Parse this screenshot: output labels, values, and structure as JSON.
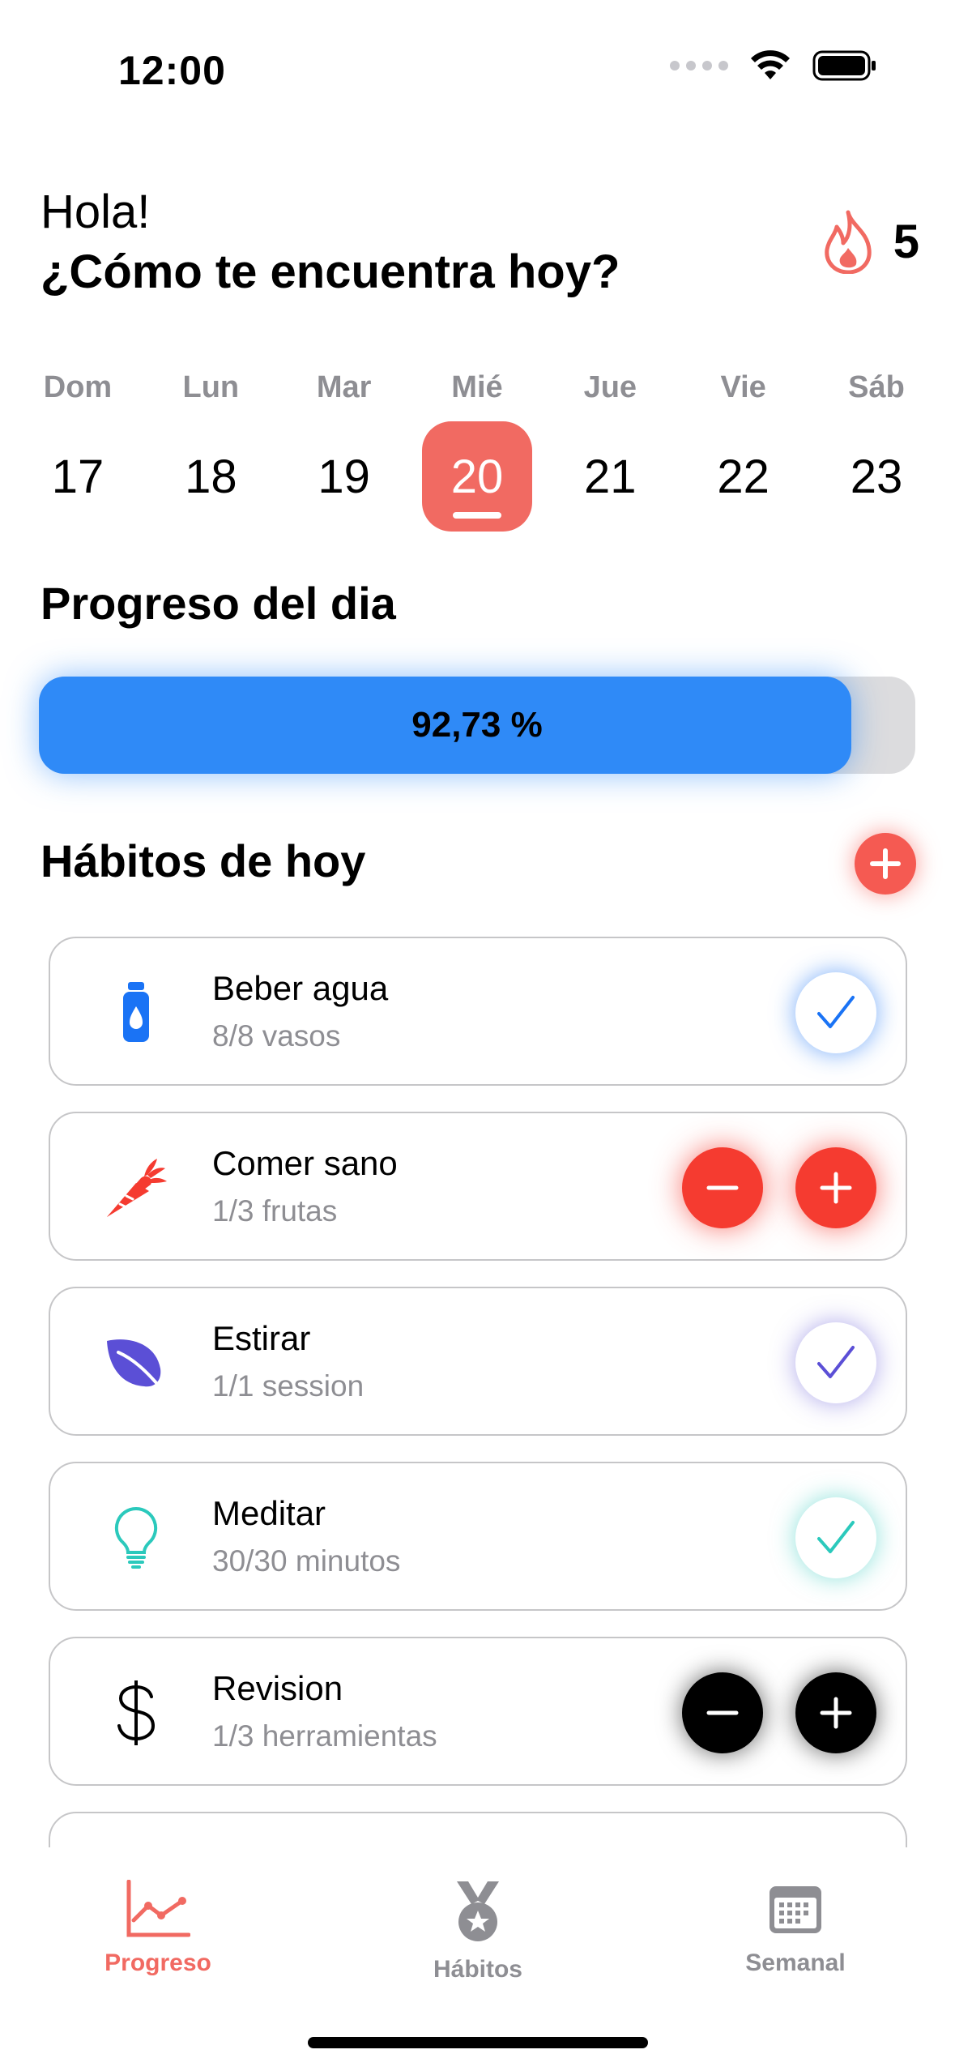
{
  "status_bar": {
    "time": "12:00",
    "icons": [
      "cellular-dots-icon",
      "wifi-icon",
      "battery-icon"
    ]
  },
  "header": {
    "greeting": "Hola!",
    "question": "¿Cómo te encuentra hoy?",
    "streak_count": "5",
    "streak_icon": "flame-icon"
  },
  "calendar": {
    "days": [
      {
        "name": "Dom",
        "number": "17",
        "active": false
      },
      {
        "name": "Lun",
        "number": "18",
        "active": false
      },
      {
        "name": "Mar",
        "number": "19",
        "active": false
      },
      {
        "name": "Mié",
        "number": "20",
        "active": true
      },
      {
        "name": "Jue",
        "number": "21",
        "active": false
      },
      {
        "name": "Vie",
        "number": "22",
        "active": false
      },
      {
        "name": "Sáb",
        "number": "23",
        "active": false
      }
    ],
    "active_color": "#f16a62"
  },
  "progress": {
    "title": "Progreso del dia",
    "label": "92,73 %",
    "value_percent": 92.73,
    "bar_color": "#2f8af7"
  },
  "habits": {
    "title": "Hábitos de hoy",
    "add_icon": "plus-circle-icon",
    "items": [
      {
        "name": "Beber agua",
        "progress": "8/8 vasos",
        "icon": "water-bottle-icon",
        "color": "#1a73f5",
        "control": "check"
      },
      {
        "name": "Comer sano",
        "progress": "1/3 frutas",
        "icon": "carrot-icon",
        "color": "#f53b30",
        "control": "stepper"
      },
      {
        "name": "Estirar",
        "progress": "1/1 session",
        "icon": "leaf-icon",
        "color": "#5b4fd6",
        "control": "check"
      },
      {
        "name": "Meditar",
        "progress": "30/30 minutos",
        "icon": "lightbulb-icon",
        "color": "#2bc9bc",
        "control": "check"
      },
      {
        "name": "Revision",
        "progress": "1/3 herramientas",
        "icon": "dollar-icon",
        "color": "#000000",
        "control": "stepper"
      }
    ]
  },
  "tab_bar": {
    "tabs": [
      {
        "label": "Progreso",
        "icon": "chart-line-icon",
        "active": true
      },
      {
        "label": "Hábitos",
        "icon": "medal-icon",
        "active": false
      },
      {
        "label": "Semanal",
        "icon": "calendar-icon",
        "active": false
      }
    ]
  }
}
